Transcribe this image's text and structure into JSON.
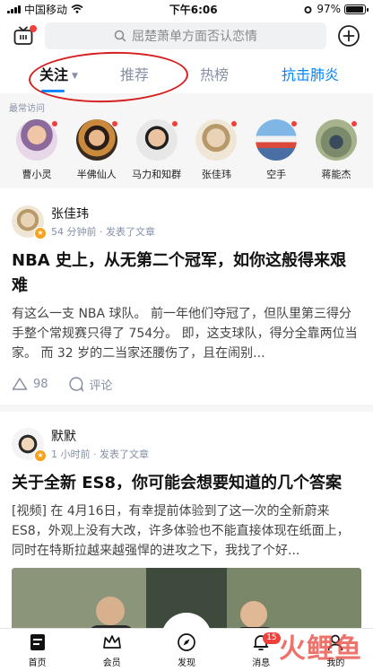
{
  "status_bar": {
    "carrier": "中国移动",
    "time": "下午6:06",
    "battery": "97%",
    "battery_level": 0.97
  },
  "search": {
    "placeholder": "屈楚萧单方面否认恋情"
  },
  "tabs": [
    {
      "label": "关注",
      "active": true
    },
    {
      "label": "推荐",
      "active": false
    },
    {
      "label": "热榜",
      "active": false
    },
    {
      "label": "抗击肺炎",
      "active": false
    }
  ],
  "recent": {
    "label": "最常访问",
    "users": [
      {
        "name": "曹小灵"
      },
      {
        "name": "半佛仙人"
      },
      {
        "name": "马力和知群"
      },
      {
        "name": "张佳玮"
      },
      {
        "name": "空手"
      },
      {
        "name": "蒋能杰"
      }
    ]
  },
  "feed": [
    {
      "author": "张佳玮",
      "meta": "54 分钟前 · 发表了文章",
      "title": "NBA 史上，从无第二个冠军，如你这般得来艰难",
      "excerpt": "有这么一支 NBA 球队。 前一年他们夺冠了，但队里第三得分手整个常规赛只得了 754分。 即，这支球队，得分全靠两位当家。 而 32 岁的二当家还腰伤了，且在闹别...",
      "likes": "98",
      "comment_label": "评论"
    },
    {
      "author": "默默",
      "meta": "1 小时前 · 发表了文章",
      "title": "关于全新 ES8，你可能会想要知道的几个答案",
      "excerpt": "[视频] 在 4月16日，有幸提前体验到了这一次的全新蔚来 ES8，外观上没有大改，许多体验也不能直接体现在纸面上，同时在特斯拉越来越强悍的进攻之下，我找了个好..."
    }
  ],
  "bottom_nav": {
    "items": [
      {
        "label": "首页"
      },
      {
        "label": "会员"
      },
      {
        "label": "发现"
      },
      {
        "label": "消息",
        "badge": "15"
      },
      {
        "label": "我的"
      }
    ]
  },
  "watermark": "火鲤鱼",
  "colors": {
    "accent": "#0084ff",
    "red": "#f1403c",
    "annotation": "#d81f1f"
  }
}
